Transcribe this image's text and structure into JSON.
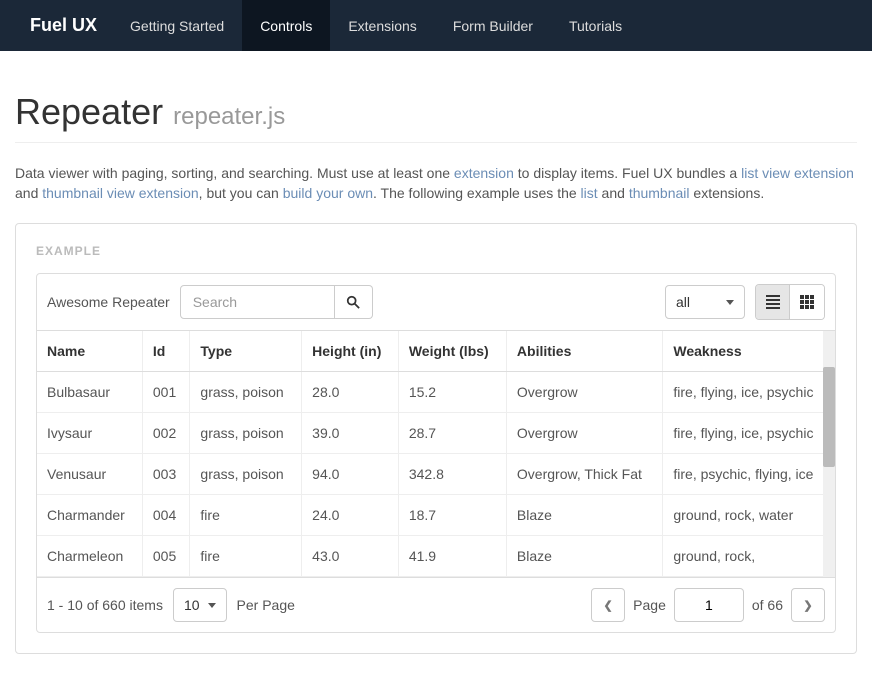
{
  "navbar": {
    "brand": "Fuel UX",
    "items": [
      "Getting Started",
      "Controls",
      "Extensions",
      "Form Builder",
      "Tutorials"
    ],
    "activeIndex": 1
  },
  "page": {
    "title": "Repeater",
    "subtitle": "repeater.js"
  },
  "intro": {
    "t1": "Data viewer with paging, sorting, and searching. Must use at least one ",
    "l1": "extension",
    "t2": " to display items. Fuel UX bundles a ",
    "l2": "list view extension",
    "t3": " and ",
    "l3": "thumbnail view extension",
    "t4": ", but you can ",
    "l4": "build your own",
    "t5": ". The following example uses the ",
    "l5": "list",
    "t6": " and ",
    "l6": "thumbnail",
    "t7": " extensions."
  },
  "example": {
    "label": "EXAMPLE",
    "repeaterTitle": "Awesome Repeater",
    "searchPlaceholder": "Search",
    "filterValue": "all",
    "columns": [
      "Name",
      "Id",
      "Type",
      "Height (in)",
      "Weight (lbs)",
      "Abilities",
      "Weakness"
    ],
    "rows": [
      {
        "name": "Bulbasaur",
        "id": "001",
        "type": "grass, poison",
        "height": "28.0",
        "weight": "15.2",
        "abilities": "Overgrow",
        "weakness": "fire, flying, ice, psychic"
      },
      {
        "name": "Ivysaur",
        "id": "002",
        "type": "grass, poison",
        "height": "39.0",
        "weight": "28.7",
        "abilities": "Overgrow",
        "weakness": "fire, flying, ice, psychic"
      },
      {
        "name": "Venusaur",
        "id": "003",
        "type": "grass, poison",
        "height": "94.0",
        "weight": "342.8",
        "abilities": "Overgrow, Thick Fat",
        "weakness": "fire, psychic, flying, ice"
      },
      {
        "name": "Charmander",
        "id": "004",
        "type": "fire",
        "height": "24.0",
        "weight": "18.7",
        "abilities": "Blaze",
        "weakness": "ground, rock, water"
      },
      {
        "name": "Charmeleon",
        "id": "005",
        "type": "fire",
        "height": "43.0",
        "weight": "41.9",
        "abilities": "Blaze",
        "weakness": "ground, rock,"
      }
    ],
    "footer": {
      "itemsInfo": "1 - 10 of 660 items",
      "pageSize": "10",
      "perPage": "Per Page",
      "pageLabel": "Page",
      "currentPage": "1",
      "totalPages": "of 66"
    }
  }
}
